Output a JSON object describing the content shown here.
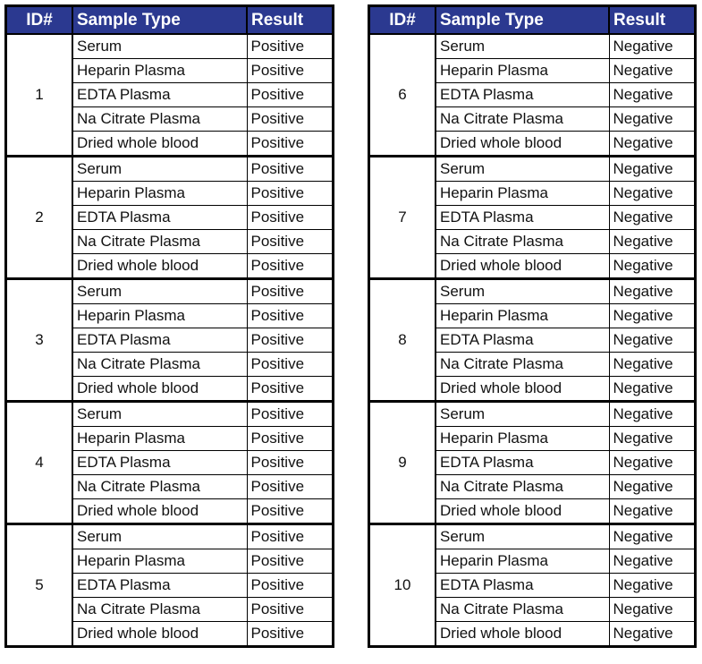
{
  "headers": {
    "id": "ID#",
    "sample_type": "Sample Type",
    "result": "Result"
  },
  "sample_types": [
    "Serum",
    "Heparin Plasma",
    "EDTA Plasma",
    "Na Citrate Plasma",
    "Dried whole blood"
  ],
  "left_table": {
    "groups": [
      {
        "id": "1",
        "results": [
          "Positive",
          "Positive",
          "Positive",
          "Positive",
          "Positive"
        ]
      },
      {
        "id": "2",
        "results": [
          "Positive",
          "Positive",
          "Positive",
          "Positive",
          "Positive"
        ]
      },
      {
        "id": "3",
        "results": [
          "Positive",
          "Positive",
          "Positive",
          "Positive",
          "Positive"
        ]
      },
      {
        "id": "4",
        "results": [
          "Positive",
          "Positive",
          "Positive",
          "Positive",
          "Positive"
        ]
      },
      {
        "id": "5",
        "results": [
          "Positive",
          "Positive",
          "Positive",
          "Positive",
          "Positive"
        ]
      }
    ]
  },
  "right_table": {
    "groups": [
      {
        "id": "6",
        "results": [
          "Negative",
          "Negative",
          "Negative",
          "Negative",
          "Negative"
        ]
      },
      {
        "id": "7",
        "results": [
          "Negative",
          "Negative",
          "Negative",
          "Negative",
          "Negative"
        ]
      },
      {
        "id": "8",
        "results": [
          "Negative",
          "Negative",
          "Negative",
          "Negative",
          "Negative"
        ]
      },
      {
        "id": "9",
        "results": [
          "Negative",
          "Negative",
          "Negative",
          "Negative",
          "Negative"
        ]
      },
      {
        "id": "10",
        "results": [
          "Negative",
          "Negative",
          "Negative",
          "Negative",
          "Negative"
        ]
      }
    ]
  },
  "colors": {
    "header_bg": "#2b3990",
    "header_text": "#ffffff"
  }
}
